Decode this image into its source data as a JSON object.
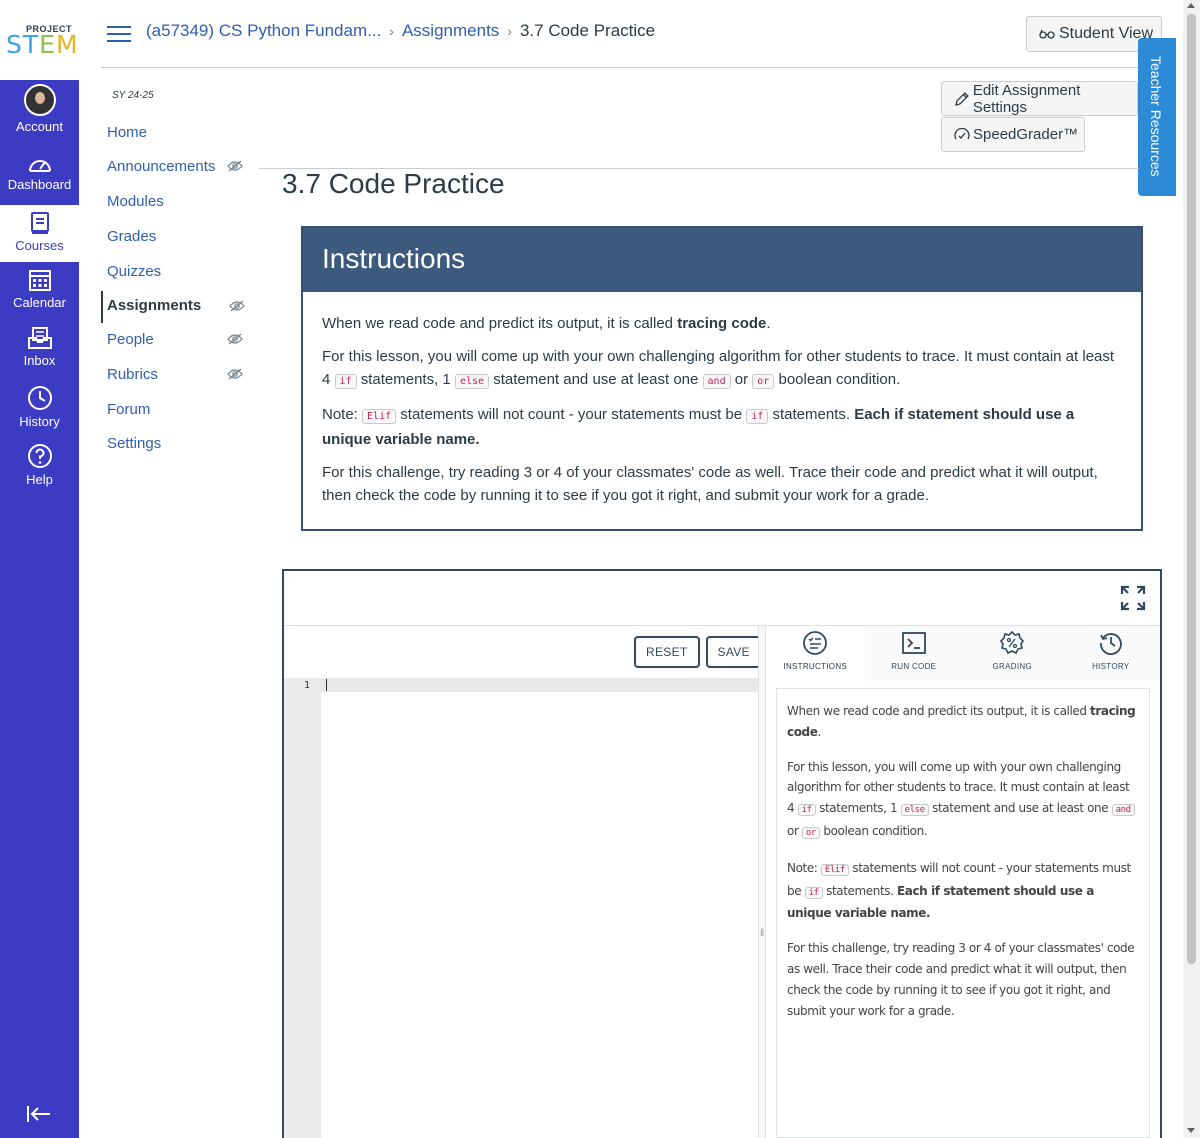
{
  "brand": {
    "project": "PROJECT",
    "stem_letters": [
      "ST",
      "E",
      "M",
      ""
    ]
  },
  "global_nav": [
    {
      "label": "Account",
      "icon": "avatar"
    },
    {
      "label": "Dashboard",
      "icon": "dashboard-icon"
    },
    {
      "label": "Courses",
      "icon": "courses-icon",
      "active": true
    },
    {
      "label": "Calendar",
      "icon": "calendar-icon"
    },
    {
      "label": "Inbox",
      "icon": "inbox-icon"
    },
    {
      "label": "History",
      "icon": "history-icon"
    },
    {
      "label": "Help",
      "icon": "help-icon"
    }
  ],
  "breadcrumb": {
    "course": "(a57349) CS Python Fundam...",
    "section": "Assignments",
    "current": "3.7 Code Practice"
  },
  "student_view_label": "Student View",
  "course_nav": {
    "term": "SY 24-25",
    "items": [
      {
        "label": "Home",
        "hidden": false
      },
      {
        "label": "Announcements",
        "hidden": true
      },
      {
        "label": "Modules",
        "hidden": false
      },
      {
        "label": "Grades",
        "hidden": false
      },
      {
        "label": "Quizzes",
        "hidden": false
      },
      {
        "label": "Assignments",
        "hidden": true,
        "active": true
      },
      {
        "label": "People",
        "hidden": true
      },
      {
        "label": "Rubrics",
        "hidden": true
      },
      {
        "label": "Forum",
        "hidden": false
      },
      {
        "label": "Settings",
        "hidden": false
      }
    ]
  },
  "actions": {
    "edit_settings": "Edit Assignment Settings",
    "speedgrader": "SpeedGrader™",
    "teacher_resources": "Teacher Resources"
  },
  "page_title": "3.7 Code Practice",
  "instructions": {
    "heading": "Instructions",
    "p1_text": "When we read code and predict its output, it is called ",
    "p1_bold": "tracing code",
    "p1_end": ".",
    "p2_a": "For this lesson, you will come up with your own challenging algorithm for other students to trace. It must contain at least 4 ",
    "p2_code1": "if",
    "p2_b": " statements, 1 ",
    "p2_code2": "else",
    "p2_c": " statement and use at least one ",
    "p2_code3": "and",
    "p2_d": " or ",
    "p2_code4": "or",
    "p2_e": " boolean condition.",
    "p3_a": "Note: ",
    "p3_code1": "Elif",
    "p3_b": " statements will not count - your statements must be ",
    "p3_code2": "if",
    "p3_c": " statements. ",
    "p3_bold": "Each if statement should use a unique variable name.",
    "p4": "For this challenge, try reading 3 or 4 of your classmates' code as well. Trace their code and predict what it will output, then check the code by running it to see if you got it right, and submit your work for a grade."
  },
  "editor": {
    "reset_label": "RESET",
    "save_label": "SAVE",
    "line_number": "1",
    "tabs": [
      {
        "label": "INSTRUCTIONS",
        "icon": "instructions-icon",
        "active": true
      },
      {
        "label": "RUN CODE",
        "icon": "terminal-icon"
      },
      {
        "label": "GRADING",
        "icon": "grading-icon"
      },
      {
        "label": "HISTORY",
        "icon": "history-icon"
      }
    ]
  },
  "colors": {
    "nav": "#3b3bc4",
    "instructions_header": "#3d5a7e",
    "link": "#2f5fae",
    "teacher_tab": "#2d8ad6"
  }
}
